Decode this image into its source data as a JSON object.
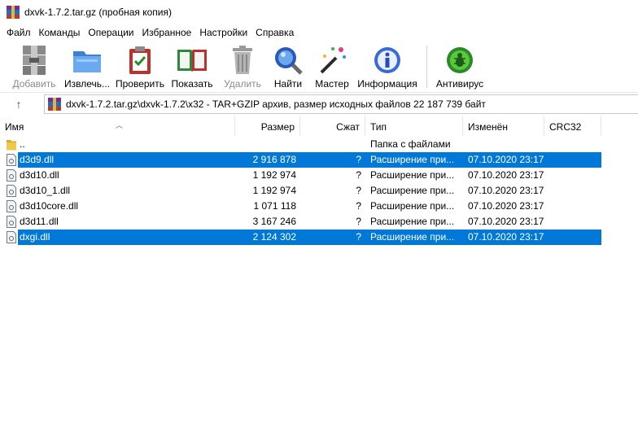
{
  "window": {
    "title": "dxvk-1.7.2.tar.gz (пробная копия)"
  },
  "menu": {
    "items": [
      "Файл",
      "Команды",
      "Операции",
      "Избранное",
      "Настройки",
      "Справка"
    ]
  },
  "toolbar": {
    "buttons": [
      {
        "label": "Добавить",
        "icon": "archive-add-icon",
        "enabled": false
      },
      {
        "label": "Извлечь...",
        "icon": "extract-folder-icon",
        "enabled": true
      },
      {
        "label": "Проверить",
        "icon": "test-clipboard-icon",
        "enabled": true
      },
      {
        "label": "Показать",
        "icon": "view-book-icon",
        "enabled": true
      },
      {
        "label": "Удалить",
        "icon": "trash-icon",
        "enabled": false
      },
      {
        "label": "Найти",
        "icon": "find-magnifier-icon",
        "enabled": true
      },
      {
        "label": "Мастер",
        "icon": "wizard-wand-icon",
        "enabled": true
      },
      {
        "label": "Информация",
        "icon": "info-icon",
        "enabled": true
      },
      {
        "label": "Антивирус",
        "icon": "antivirus-bug-icon",
        "enabled": true
      }
    ]
  },
  "address": {
    "up_icon": "↑",
    "path": "dxvk-1.7.2.tar.gz\\dxvk-1.7.2\\x32 - TAR+GZIP архив, размер исходных файлов 22 187 739 байт"
  },
  "list": {
    "columns": [
      "Имя",
      "Размер",
      "Сжат",
      "Тип",
      "Изменён",
      "CRC32"
    ],
    "rows": [
      {
        "name": "..",
        "size": "",
        "packed": "",
        "type": "Папка с файлами",
        "modified": "",
        "kind": "folder",
        "selected": false
      },
      {
        "name": "d3d9.dll",
        "size": "2 916 878",
        "packed": "?",
        "type": "Расширение при...",
        "modified": "07.10.2020 23:17",
        "kind": "dll",
        "selected": true
      },
      {
        "name": "d3d10.dll",
        "size": "1 192 974",
        "packed": "?",
        "type": "Расширение при...",
        "modified": "07.10.2020 23:17",
        "kind": "dll",
        "selected": false
      },
      {
        "name": "d3d10_1.dll",
        "size": "1 192 974",
        "packed": "?",
        "type": "Расширение при...",
        "modified": "07.10.2020 23:17",
        "kind": "dll",
        "selected": false
      },
      {
        "name": "d3d10core.dll",
        "size": "1 071 118",
        "packed": "?",
        "type": "Расширение при...",
        "modified": "07.10.2020 23:17",
        "kind": "dll",
        "selected": false
      },
      {
        "name": "d3d11.dll",
        "size": "3 167 246",
        "packed": "?",
        "type": "Расширение при...",
        "modified": "07.10.2020 23:17",
        "kind": "dll",
        "selected": false
      },
      {
        "name": "dxgi.dll",
        "size": "2 124 302",
        "packed": "?",
        "type": "Расширение при...",
        "modified": "07.10.2020 23:17",
        "kind": "dll",
        "selected": true
      }
    ]
  },
  "colors": {
    "selection": "#0078d7",
    "folder": "#f0c84a"
  }
}
